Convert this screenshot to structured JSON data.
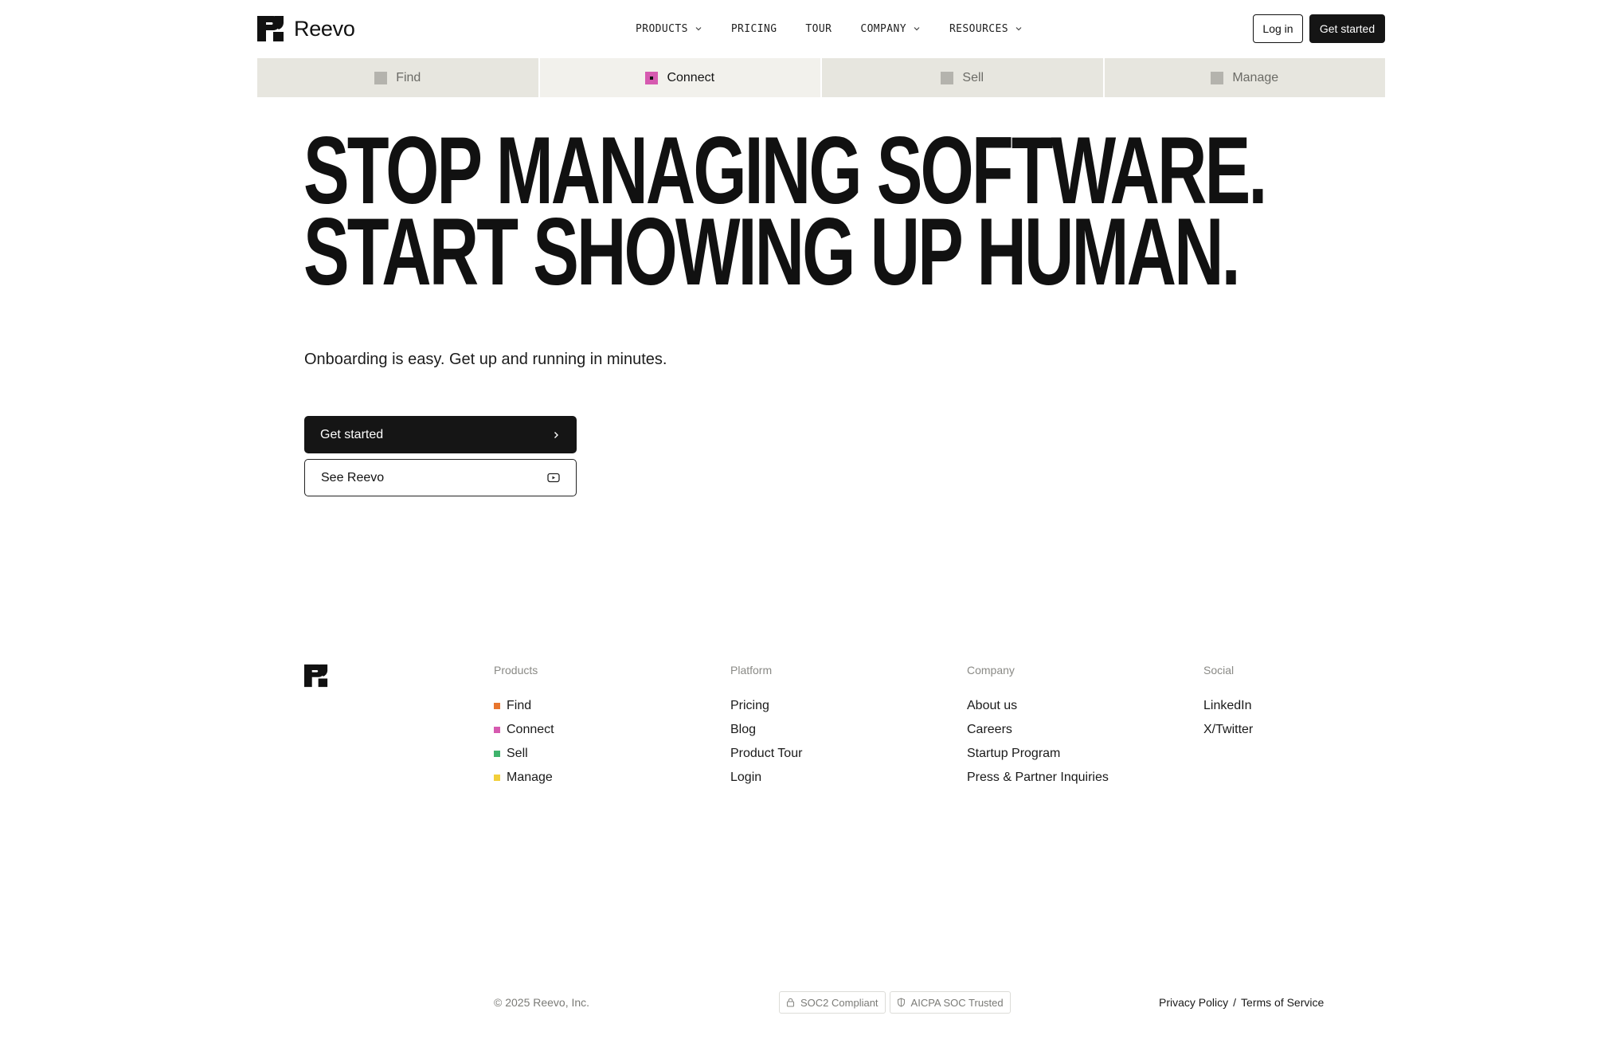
{
  "brand": {
    "name": "Reevo"
  },
  "nav": {
    "items": [
      {
        "label": "PRODUCTS",
        "has_menu": true
      },
      {
        "label": "PRICING",
        "has_menu": false
      },
      {
        "label": "TOUR",
        "has_menu": false
      },
      {
        "label": "COMPANY",
        "has_menu": true
      },
      {
        "label": "RESOURCES",
        "has_menu": true
      }
    ],
    "login_label": "Log in",
    "get_started_label": "Get started"
  },
  "tabs": [
    {
      "label": "Find",
      "active": false
    },
    {
      "label": "Connect",
      "active": true
    },
    {
      "label": "Sell",
      "active": false
    },
    {
      "label": "Manage",
      "active": false
    }
  ],
  "hero": {
    "line1": "STOP MANAGING SOFTWARE.",
    "line2": "START SHOWING UP HUMAN.",
    "subtitle": "Onboarding is easy. Get up and running in minutes.",
    "primary_cta": "Get started",
    "secondary_cta": "See Reevo"
  },
  "footer": {
    "columns": [
      {
        "title": "Products",
        "links": [
          {
            "label": "Find",
            "color": "#e8762e"
          },
          {
            "label": "Connect",
            "color": "#d65ab0"
          },
          {
            "label": "Sell",
            "color": "#3fb36c"
          },
          {
            "label": "Manage",
            "color": "#f2cf3a"
          }
        ]
      },
      {
        "title": "Platform",
        "links": [
          {
            "label": "Pricing"
          },
          {
            "label": "Blog"
          },
          {
            "label": "Product Tour"
          },
          {
            "label": "Login"
          }
        ]
      },
      {
        "title": "Company",
        "links": [
          {
            "label": "About us"
          },
          {
            "label": "Careers"
          },
          {
            "label": "Startup Program"
          },
          {
            "label": "Press & Partner Inquiries"
          }
        ]
      },
      {
        "title": "Social",
        "links": [
          {
            "label": "LinkedIn"
          },
          {
            "label": "X/Twitter"
          }
        ]
      }
    ],
    "copyright": "© 2025 Reevo, Inc.",
    "badges": [
      {
        "label": "SOC2 Compliant",
        "icon": "lock-icon"
      },
      {
        "label": "AICPA SOC Trusted",
        "icon": "shield-icon"
      }
    ],
    "legal": {
      "privacy": "Privacy Policy",
      "separator": "/",
      "terms": "Terms of Service"
    }
  }
}
